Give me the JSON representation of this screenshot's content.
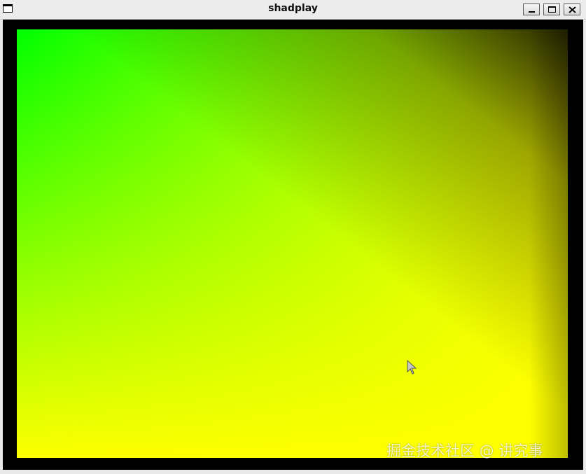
{
  "window": {
    "title": "shadplay",
    "controls": {
      "minimize_icon": "minimize-icon",
      "maximize_icon": "maximize-icon",
      "close_icon": "close-icon"
    }
  },
  "canvas": {
    "colors": {
      "top_left": "#00ff00",
      "bottom_left": "#ffff00",
      "bottom_right": "#ff1a00",
      "top_right": "#000000"
    }
  },
  "watermark": "掘金技术社区 @ 讲究事"
}
